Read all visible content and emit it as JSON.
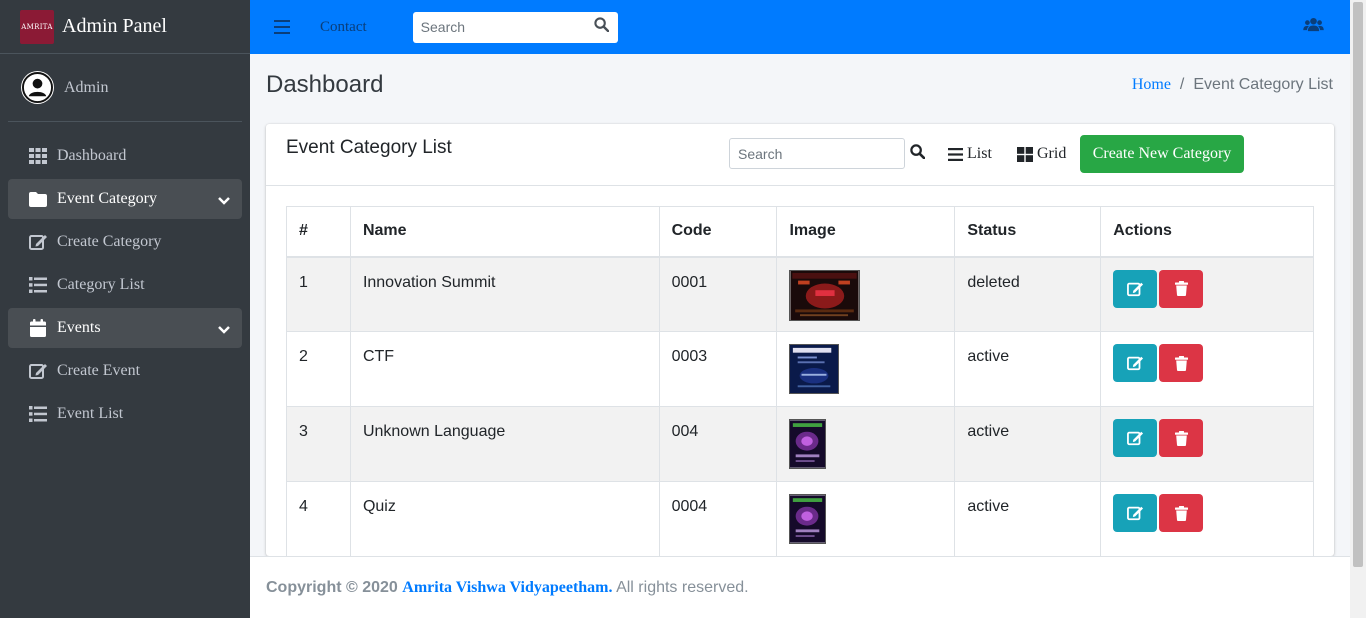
{
  "brand": {
    "title": "Admin Panel",
    "logo_text": "AMRITA"
  },
  "user": {
    "name": "Admin"
  },
  "sidebar": {
    "items": [
      {
        "label": "Dashboard",
        "icon": "th-icon"
      },
      {
        "label": "Event Category",
        "icon": "folder-icon",
        "open": true
      },
      {
        "label": "Create Category",
        "icon": "edit-icon"
      },
      {
        "label": "Category List",
        "icon": "list-icon"
      },
      {
        "label": "Events",
        "icon": "calendar-icon",
        "open": true
      },
      {
        "label": "Create Event",
        "icon": "edit-icon"
      },
      {
        "label": "Event List",
        "icon": "list-icon"
      }
    ]
  },
  "topbar": {
    "contact_label": "Contact",
    "search_placeholder": "Search"
  },
  "header": {
    "title": "Dashboard",
    "breadcrumb": {
      "home": "Home",
      "separator": "/",
      "current": "Event Category List"
    }
  },
  "card": {
    "title": "Event Category List",
    "search_placeholder": "Search",
    "list_label": "List",
    "grid_label": "Grid",
    "create_label": "Create New Category"
  },
  "table": {
    "columns": [
      "#",
      "Name",
      "Code",
      "Image",
      "Status",
      "Actions"
    ],
    "rows": [
      {
        "num": "1",
        "name": "Innovation Summit",
        "code": "0001",
        "status": "deleted"
      },
      {
        "num": "2",
        "name": "CTF",
        "code": "0003",
        "status": "active"
      },
      {
        "num": "3",
        "name": "Unknown Language",
        "code": "004",
        "status": "active"
      },
      {
        "num": "4",
        "name": "Quiz",
        "code": "0004",
        "status": "active"
      }
    ]
  },
  "footer": {
    "prefix": "Copyright © 2020",
    "link": "Amrita Vishwa Vidyapeetham.",
    "suffix": "All rights reserved."
  },
  "colors": {
    "topbar": "#007bff",
    "sidebar": "#343a40",
    "success": "#28a745",
    "info": "#17a2b8",
    "danger": "#dc3545"
  }
}
